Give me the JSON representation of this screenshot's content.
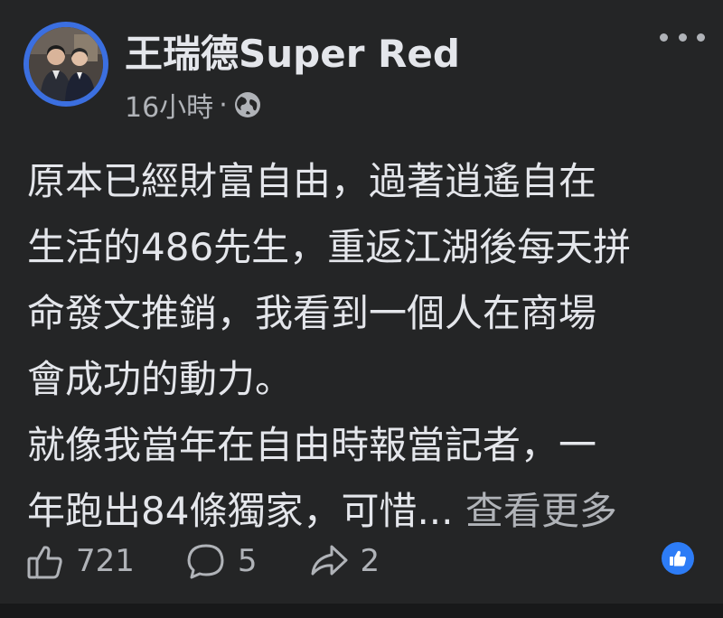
{
  "post": {
    "author": "王瑞德Super Red",
    "time": "16小時",
    "time_separator": "·",
    "body_lines": [
      "原本已經財富自由，過著逍遙自在",
      "生活的486先生，重返江湖後每天拼",
      "命發文推銷，我看到一個人在商場",
      "會成功的動力。",
      "就像我當年在自由時報當記者，一",
      "年跑出84條獨家，可惜..."
    ],
    "see_more": "查看更多",
    "likes": "721",
    "comments": "5",
    "shares": "2",
    "reaction_icon": "like-icon",
    "colors": {
      "background": "#242526",
      "text": "#e4e6eb",
      "secondary": "#b0b3b8",
      "accent": "#2d7cf6"
    }
  }
}
